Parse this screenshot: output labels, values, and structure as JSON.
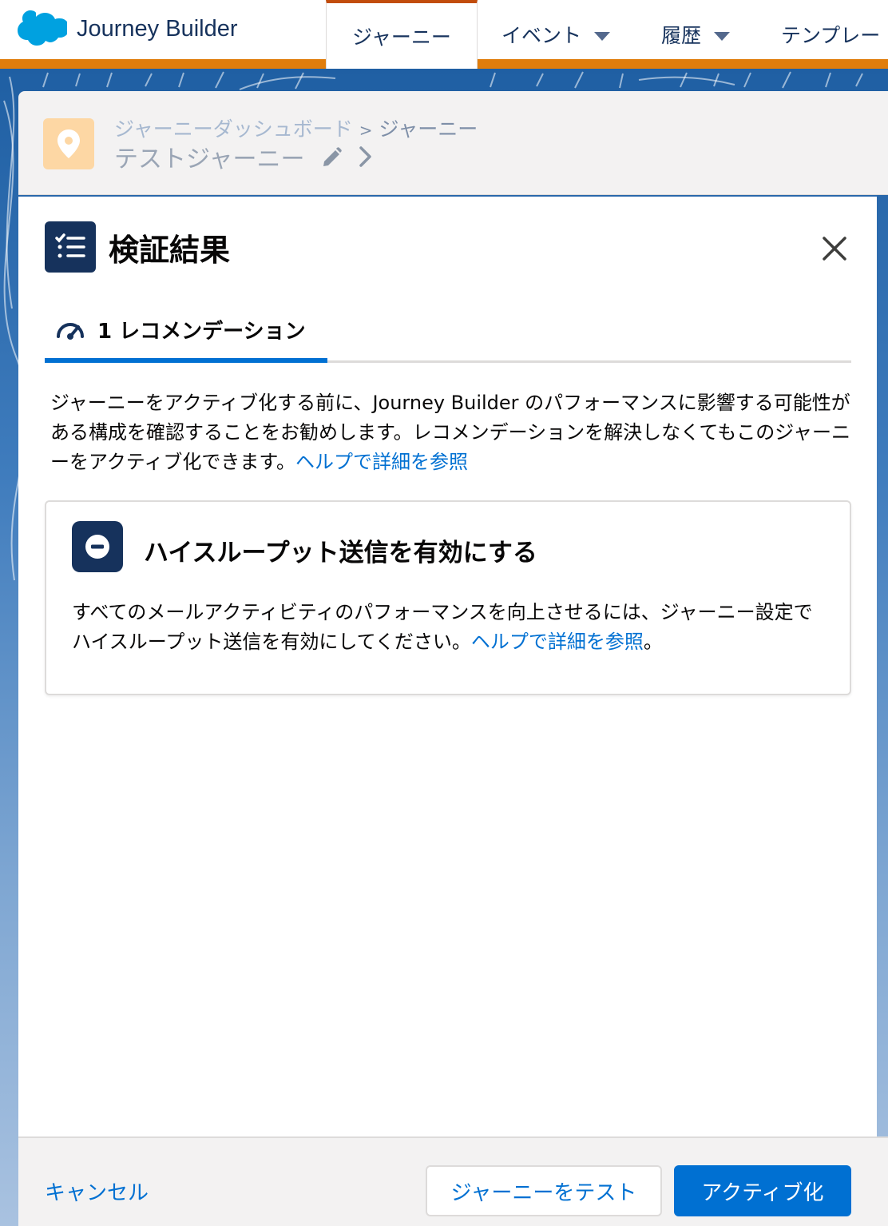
{
  "app": {
    "name": "Journey Builder"
  },
  "nav": {
    "tabs": [
      {
        "label": "ジャーニー"
      },
      {
        "label": "イベント"
      },
      {
        "label": "履歴"
      },
      {
        "label": "テンプレー"
      }
    ]
  },
  "journey": {
    "breadcrumb": {
      "dashboard": "ジャーニーダッシュボード",
      "separator": ">",
      "current": "ジャーニー"
    },
    "name": "テストジャーニー"
  },
  "panel": {
    "title": "検証結果",
    "tab": {
      "count": "1",
      "label": "レコメンデーション"
    },
    "intro": {
      "text": "ジャーニーをアクティブ化する前に、Journey Builder のパフォーマンスに影響する可能性がある構成を確認することをお勧めします。レコメンデーションを解決しなくてもこのジャーニーをアクティブ化できます。",
      "link": "ヘルプで詳細を参照"
    },
    "recommendation": {
      "title": "ハイスループット送信を有効にする",
      "body": "すべてのメールアクティビティのパフォーマンスを向上させるには、ジャーニー設定でハイスループット送信を有効にしてください。",
      "link": "ヘルプで詳細を参照",
      "suffix": "。"
    }
  },
  "footer": {
    "cancel": "キャンセル",
    "test": "ジャーニーをテスト",
    "activate": "アクティブ化"
  },
  "colors": {
    "brand_orange": "#e07d0c",
    "navy": "#16325c",
    "link_blue": "#0070d2",
    "pin_tile": "#fdd7a4"
  },
  "icons": {
    "logo": "salesforce-cloud-icon",
    "pin": "location-pin-icon",
    "edit": "pencil-icon",
    "chevron": "chevron-right-icon",
    "panel": "checklist-icon",
    "close": "close-icon",
    "tab": "gauge-icon",
    "recommendation": "minus-circle-icon"
  }
}
